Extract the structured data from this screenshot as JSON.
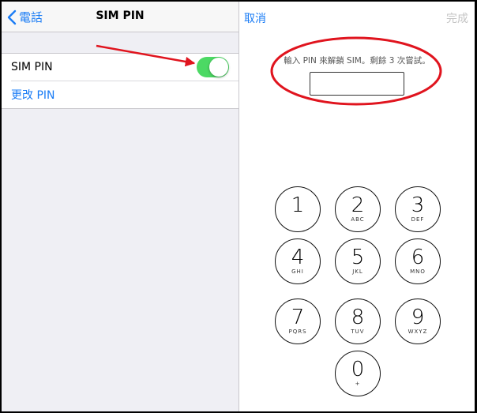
{
  "left_nav": {
    "back_label": "電話",
    "title": "SIM PIN"
  },
  "settings": {
    "sim_pin_label": "SIM PIN",
    "sim_pin_enabled": true,
    "change_pin_label": "更改 PIN"
  },
  "pin_panel": {
    "cancel_label": "取消",
    "done_label": "完成",
    "prompt": "輸入 PIN 來解鎖 SIM。剩餘 3 次嘗試。"
  },
  "keypad": [
    {
      "digit": "1",
      "letters": ""
    },
    {
      "digit": "2",
      "letters": "ABC"
    },
    {
      "digit": "3",
      "letters": "DEF"
    },
    {
      "digit": "4",
      "letters": "GHI"
    },
    {
      "digit": "5",
      "letters": "JKL"
    },
    {
      "digit": "6",
      "letters": "MNO"
    },
    {
      "digit": "7",
      "letters": "PQRS"
    },
    {
      "digit": "8",
      "letters": "TUV"
    },
    {
      "digit": "9",
      "letters": "WXYZ"
    },
    {
      "digit": "0",
      "letters": "+"
    }
  ],
  "colors": {
    "accent": "#1a7cf5",
    "toggle_on": "#4cd964",
    "annotation": "#e0141e"
  }
}
